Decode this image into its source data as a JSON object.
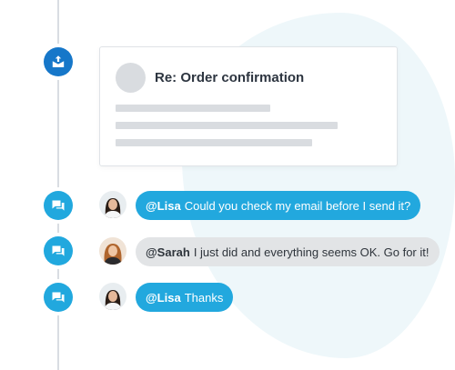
{
  "email": {
    "subject": "Re: Order confirmation"
  },
  "messages": [
    {
      "mention": "@Lisa",
      "text": "Could you check my email before I send it?",
      "style": "blue"
    },
    {
      "mention": "@Sarah",
      "text": "I just did and everything seems OK. Go for it!",
      "style": "grey"
    },
    {
      "mention": "@Lisa",
      "text": "Thanks",
      "style": "blue"
    }
  ],
  "icons": {
    "email_event": "email-upload-icon",
    "chat_event": "chat-bubbles-icon"
  },
  "colors": {
    "email_icon_bg": "#1677c9",
    "chat_icon_bg": "#21a8de",
    "bubble_blue": "#22a8de",
    "bubble_grey": "#e2e4e6",
    "blob": "#eef7fa"
  }
}
